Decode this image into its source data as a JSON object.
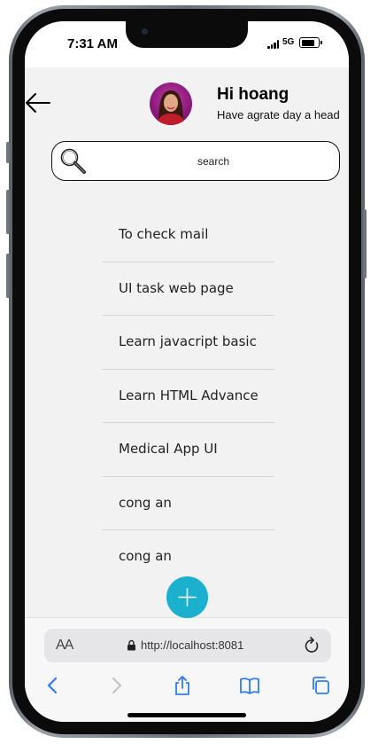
{
  "status_bar": {
    "time": "7:31 AM",
    "network": "5G"
  },
  "header": {
    "greeting": "Hi hoang",
    "subtitle": "Have agrate day a head",
    "back_icon": "arrow-left-icon"
  },
  "search": {
    "text": "search",
    "icon": "search-icon"
  },
  "tasks": [
    "To check mail",
    "UI task web page",
    "Learn javacript basic",
    "Learn HTML Advance",
    "Medical App UI",
    "cong an",
    "cong an"
  ],
  "fab": {
    "icon": "plus-icon",
    "color": "#1cb0cf"
  },
  "browser": {
    "aa_label": "AA",
    "url": "http://localhost:8081",
    "toolbar_icons": [
      "chevron-left-icon",
      "chevron-right-icon",
      "share-icon",
      "book-icon",
      "tabs-icon"
    ],
    "accent": "#2f7df6"
  }
}
